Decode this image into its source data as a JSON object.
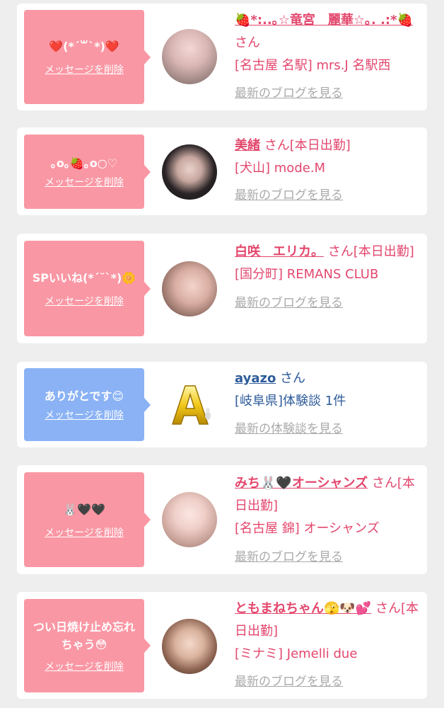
{
  "colors": {
    "pink_bubble": "#fa97a4",
    "blue_bubble": "#8ab2f5",
    "name_pink": "#e3476d",
    "name_blue": "#2d5b9a",
    "link_gray": "#aaaaaa"
  },
  "messages": [
    {
      "message": "❤️(*´꒳`*)❤️",
      "delete_label": "メッセージを削除",
      "name": "🍓*:..｡☆竜宮　麗華☆｡. .:*🍓",
      "san": "さん",
      "status": "",
      "location": "[名古屋 名駅] mrs.J 名駅西",
      "link": "最新のブログを見る"
    },
    {
      "message": "｡o｡🍓｡o○♡",
      "delete_label": "メッセージを削除",
      "name": "美緒",
      "san": "さん",
      "status": "[本日出勤]",
      "location": "[犬山] mode.M",
      "link": "最新のブログを見る"
    },
    {
      "message": "SPいいね(*´˘`*)🌼",
      "delete_label": "メッセージを削除",
      "name": "白咲　エリカ。",
      "san": "さん",
      "status": "[本日出勤]",
      "location": "[国分町] REMANS CLUB",
      "link": "最新のブログを見る"
    },
    {
      "message": "ありがとです😊",
      "delete_label": "メッセージを削除",
      "name": "ayazo",
      "san": "さん",
      "status": "",
      "location": "[岐阜県]体験談 1件",
      "link": "最新の体験談を見る"
    },
    {
      "message": "🐰🖤🖤",
      "delete_label": "メッセージを削除",
      "name": "みち🐰🖤オーシャンズ",
      "san": "さん",
      "status": "[本日出勤]",
      "location": "[名古屋 錦] オーシャンズ",
      "link": "最新のブログを見る"
    },
    {
      "message": "つい日焼け止め忘れちゃう😳",
      "delete_label": "メッセージを削除",
      "name": "ともまねちゃん🫣🐶💕",
      "san": "さん",
      "status": "[本日出勤]",
      "location": "[ミナミ] Jemelli due",
      "link": "最新のブログを見る"
    }
  ]
}
